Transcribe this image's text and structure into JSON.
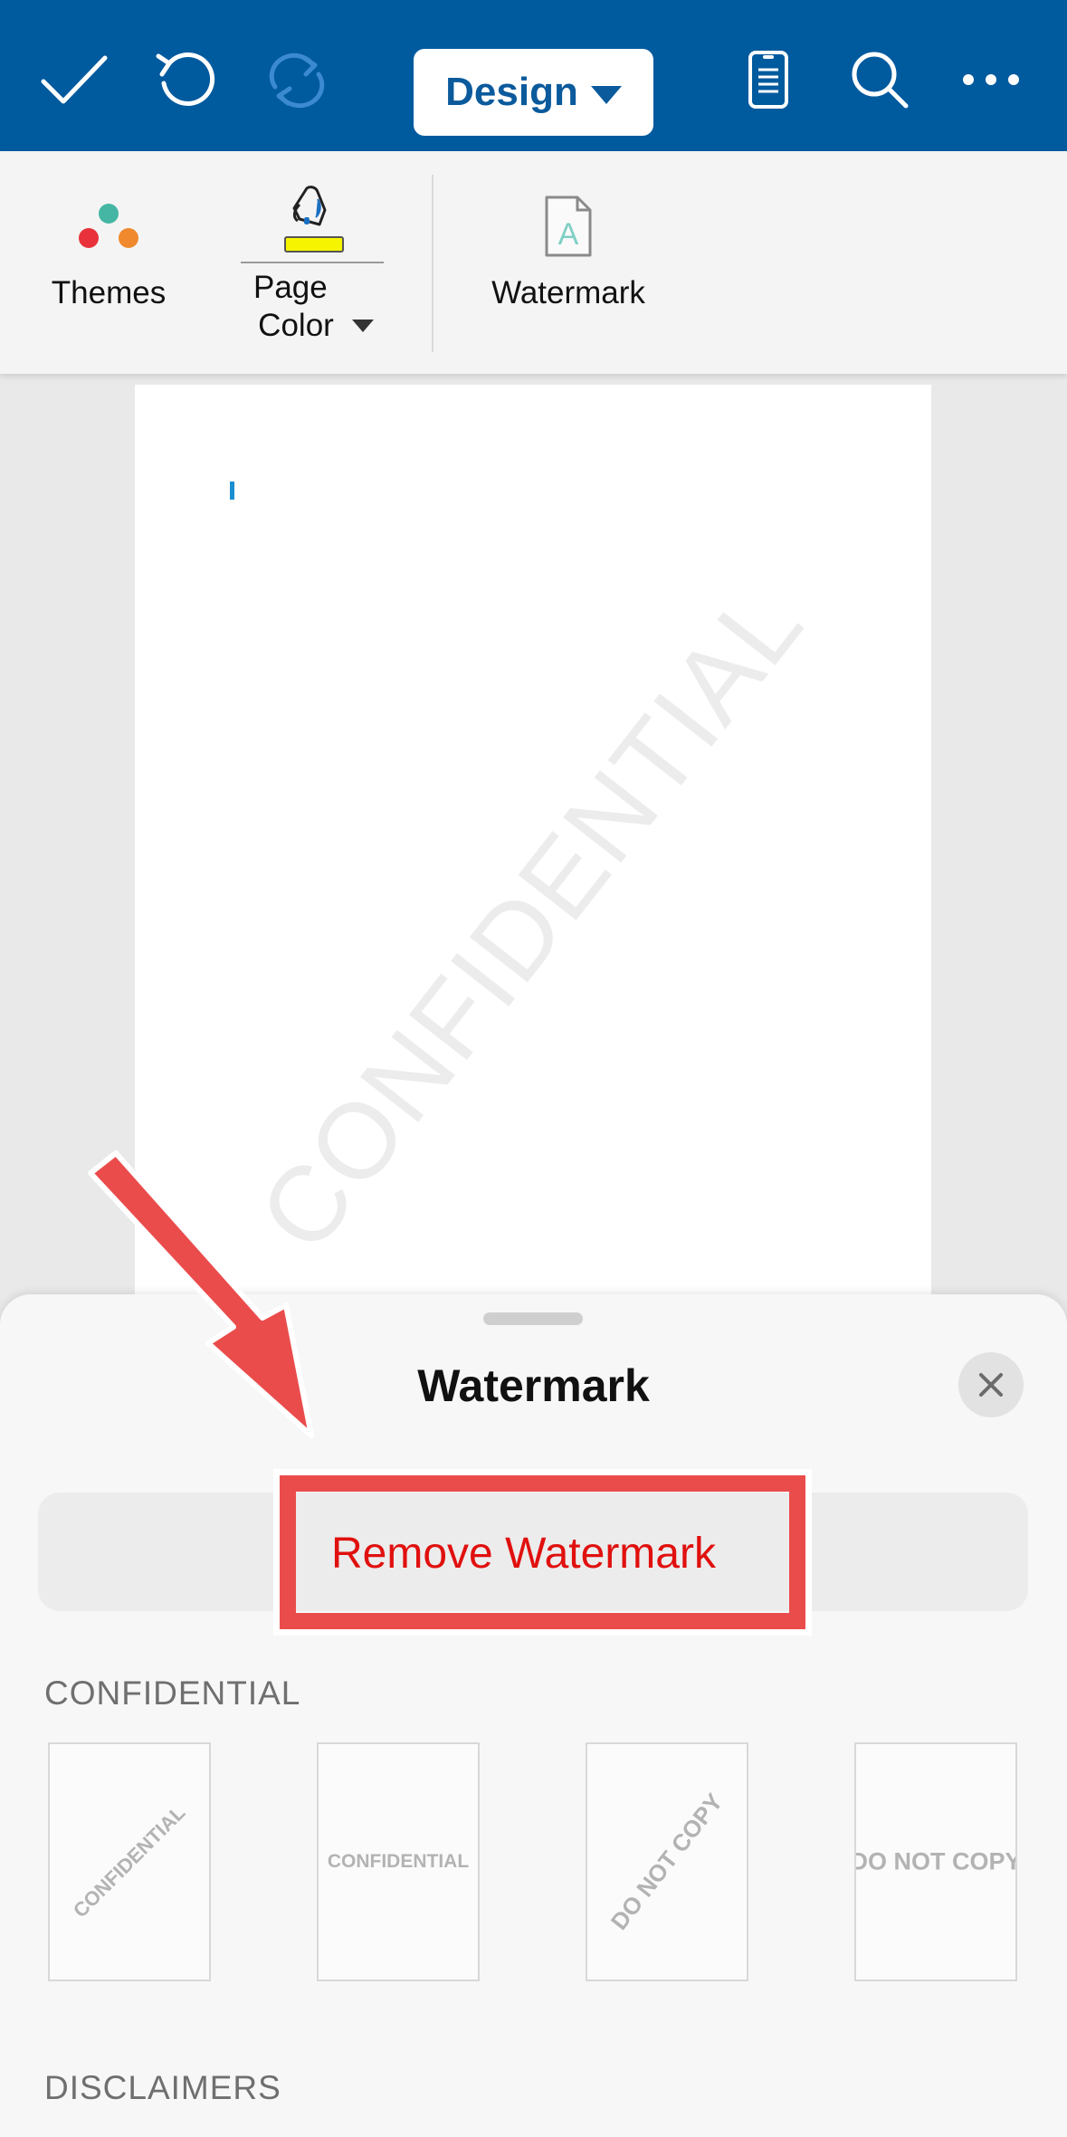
{
  "toolbar": {
    "design_label": "Design",
    "icons": [
      "checkmark-icon",
      "undo-icon",
      "redo-icon",
      "mobile-view-icon",
      "search-icon",
      "more-icon"
    ]
  },
  "ribbon": {
    "themes_label": "Themes",
    "page_color_label_1": "Page",
    "page_color_label_2": "Color",
    "watermark_label": "Watermark",
    "page_color_swatch": "#f7f400"
  },
  "document": {
    "watermark_text": "CONFIDENTIAL"
  },
  "sheet": {
    "title": "Watermark",
    "remove_label": "Remove Watermark",
    "section_confidential": "CONFIDENTIAL",
    "section_disclaimers": "DISCLAIMERS",
    "thumbnails": [
      {
        "text": "CONFIDENTIAL",
        "style": "diagonal"
      },
      {
        "text": "CONFIDENTIAL",
        "style": "horizontal"
      },
      {
        "text": "DO NOT COPY",
        "style": "diagonal"
      },
      {
        "text": "DO NOT COPY",
        "style": "horizontal"
      }
    ]
  },
  "colors": {
    "accent": "#005a9e",
    "annotation": "#ea4c4c",
    "remove_text": "#e0100e"
  }
}
